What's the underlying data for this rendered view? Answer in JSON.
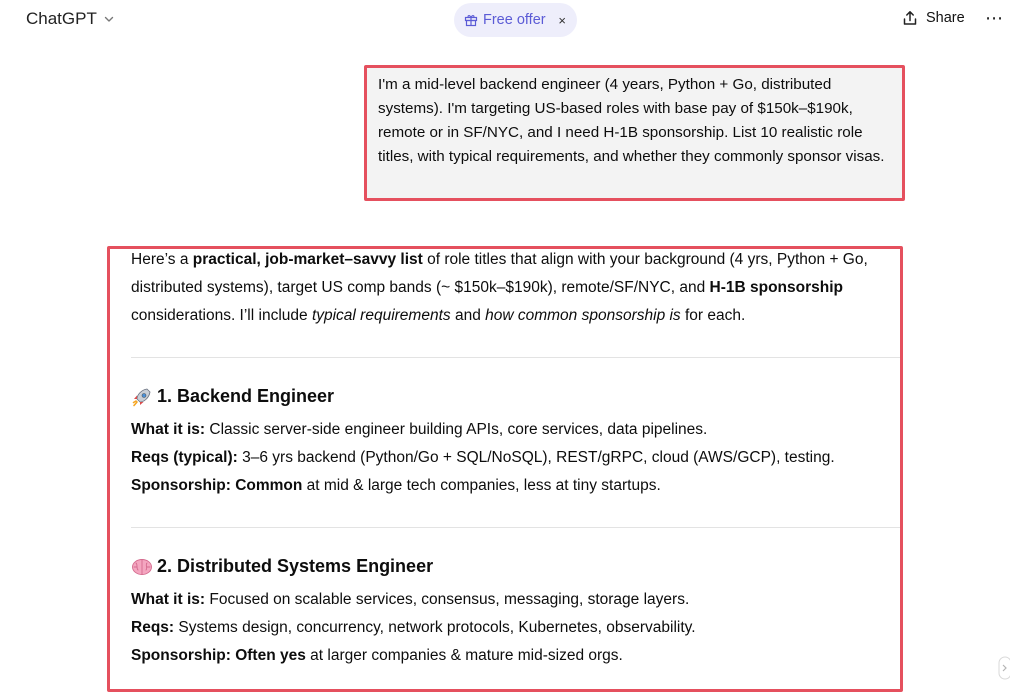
{
  "header": {
    "model_name": "ChatGPT",
    "offer_label": "Free offer",
    "offer_close": "×",
    "share_label": "Share",
    "more_label": "⋯"
  },
  "user_message": "I'm a mid-level backend engineer (4 years, Python + Go, distributed systems). I'm targeting US-based roles with base pay of $150k–$190k, remote or in SF/NYC, and I need H-1B sponsorship. List 10 realistic role titles, with typical requirements, and whether they commonly sponsor visas.",
  "assistant": {
    "intro": {
      "t1": "Here’s a ",
      "b1": "practical, job-market–savvy list",
      "t2": " of role titles that align with your background (4 yrs, Python + Go, distributed systems), target US comp bands (~ $150k–$190k), remote/SF/NYC, and ",
      "b2": "H-1B sponsorship",
      "t3": " considerations. I’ll include ",
      "i1": "typical requirements",
      "t4": " and ",
      "i2": "how common sponsorship is",
      "t5": " for each."
    },
    "sections": [
      {
        "title": "1. Backend Engineer",
        "icon": "rocket-icon",
        "what_label": "What it is:",
        "what_text": " Classic server-side engineer building APIs, core services, data pipelines.",
        "reqs_label": "Reqs (typical):",
        "reqs_text": " 3–6 yrs backend (Python/Go + SQL/NoSQL), REST/gRPC, cloud (AWS/GCP), testing.",
        "spon_label": "Sponsorship:",
        "spon_bold": " Common",
        "spon_text": " at mid & large tech companies, less at tiny startups."
      },
      {
        "title": "2. Distributed Systems Engineer",
        "icon": "brain-icon",
        "what_label": "What it is:",
        "what_text": " Focused on scalable services, consensus, messaging, storage layers.",
        "reqs_label": "Reqs:",
        "reqs_text": " Systems design, concurrency, network protocols, Kubernetes, observability.",
        "spon_label": "Sponsorship:",
        "spon_bold": " Often yes",
        "spon_text": " at larger companies & mature mid-sized orgs."
      }
    ]
  },
  "colors": {
    "highlight_border": "#e5505e",
    "offer_bg": "#eeeefb",
    "offer_text": "#5b5bd6",
    "user_bubble": "#f3f3f3"
  }
}
